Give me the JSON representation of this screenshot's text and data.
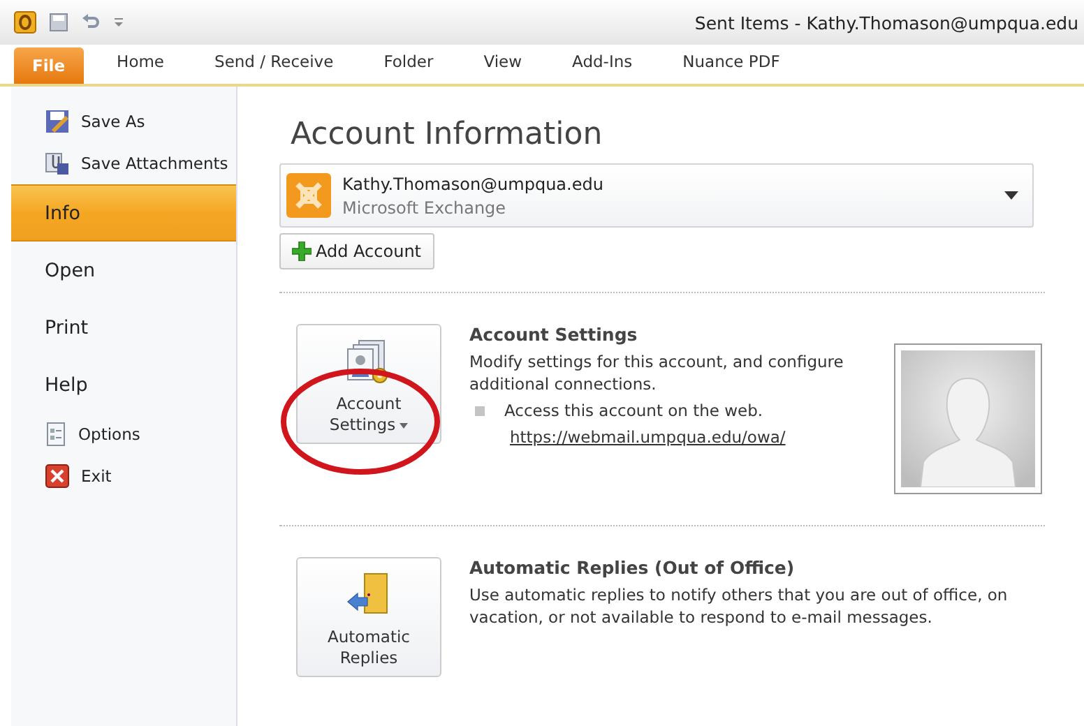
{
  "window": {
    "title": "Sent Items - Kathy.Thomason@umpqua.edu"
  },
  "tabs": [
    {
      "label": "File",
      "selected": true
    },
    {
      "label": "Home",
      "selected": false
    },
    {
      "label": "Send / Receive",
      "selected": false
    },
    {
      "label": "Folder",
      "selected": false
    },
    {
      "label": "View",
      "selected": false
    },
    {
      "label": "Add-Ins",
      "selected": false
    },
    {
      "label": "Nuance PDF",
      "selected": false
    }
  ],
  "sidebar": {
    "items": [
      {
        "label": "Save As",
        "kind": "command",
        "selected": false
      },
      {
        "label": "Save Attachments",
        "kind": "command",
        "selected": false
      },
      {
        "label": "Info",
        "kind": "page",
        "selected": true
      },
      {
        "label": "Open",
        "kind": "page",
        "selected": false
      },
      {
        "label": "Print",
        "kind": "page",
        "selected": false
      },
      {
        "label": "Help",
        "kind": "page",
        "selected": false
      },
      {
        "label": "Options",
        "kind": "command",
        "selected": false
      },
      {
        "label": "Exit",
        "kind": "command",
        "selected": false
      }
    ]
  },
  "heading": "Account Information",
  "account": {
    "email": "Kathy.Thomason@umpqua.edu",
    "type": "Microsoft Exchange"
  },
  "add_account": "Add Account",
  "sections": [
    {
      "button": [
        "Account",
        "Settings"
      ],
      "has_menu": true,
      "title": "Account Settings",
      "description": "Modify settings for this account, and configure additional connections.",
      "bullet": "Access this account on the web.",
      "link": "https://webmail.umpqua.edu/owa/",
      "photo": true,
      "circled": true
    },
    {
      "button": [
        "Automatic",
        "Replies"
      ],
      "has_menu": false,
      "title": "Automatic Replies (Out of Office)",
      "description": "Use automatic replies to notify others that you are out of office, on vacation, or not available to respond to e-mail messages.",
      "photo": false,
      "circled": false
    }
  ]
}
